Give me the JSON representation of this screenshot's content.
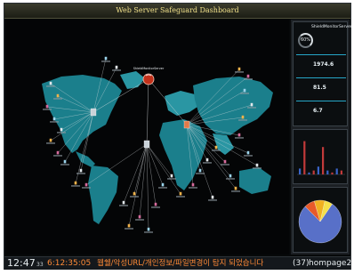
{
  "window": {
    "title": "Web Server Safeguard Dashboard"
  },
  "map": {
    "center_label": "ShieldMonitorServer",
    "colors": {
      "land": "#1b7f8c",
      "land_light": "#2a96a3",
      "lines": "#d9dde0",
      "center": "#c2301a"
    }
  },
  "side_panel": {
    "server_name": "ShieldMonitorServer",
    "gauge": {
      "value": "60%",
      "fraction": 0.6
    },
    "metrics": [
      {
        "value": "1974.6",
        "unit": ""
      },
      {
        "value": "81.5",
        "unit": ""
      },
      {
        "value": "6.7",
        "unit": ""
      }
    ],
    "graph_bars": [
      0.15,
      0.85,
      0.05,
      0.1,
      0.2,
      0.7,
      0.1,
      0.05,
      0.15,
      0.1
    ],
    "pie": [
      {
        "fraction": 0.78,
        "color": "#5870c8"
      },
      {
        "fraction": 0.08,
        "color": "#e85a2a"
      },
      {
        "fraction": 0.08,
        "color": "#f0b020"
      },
      {
        "fraction": 0.06,
        "color": "#f5e04a"
      }
    ]
  },
  "status_bar": {
    "clock": "12:47",
    "clock_seconds": "33",
    "event_time": "6:12:35:05",
    "event_message": "웹쉘/악성URL/개인정보/파일변경이 탐지 되었습니다",
    "event_count": "(37)",
    "event_host": "hompage2"
  }
}
